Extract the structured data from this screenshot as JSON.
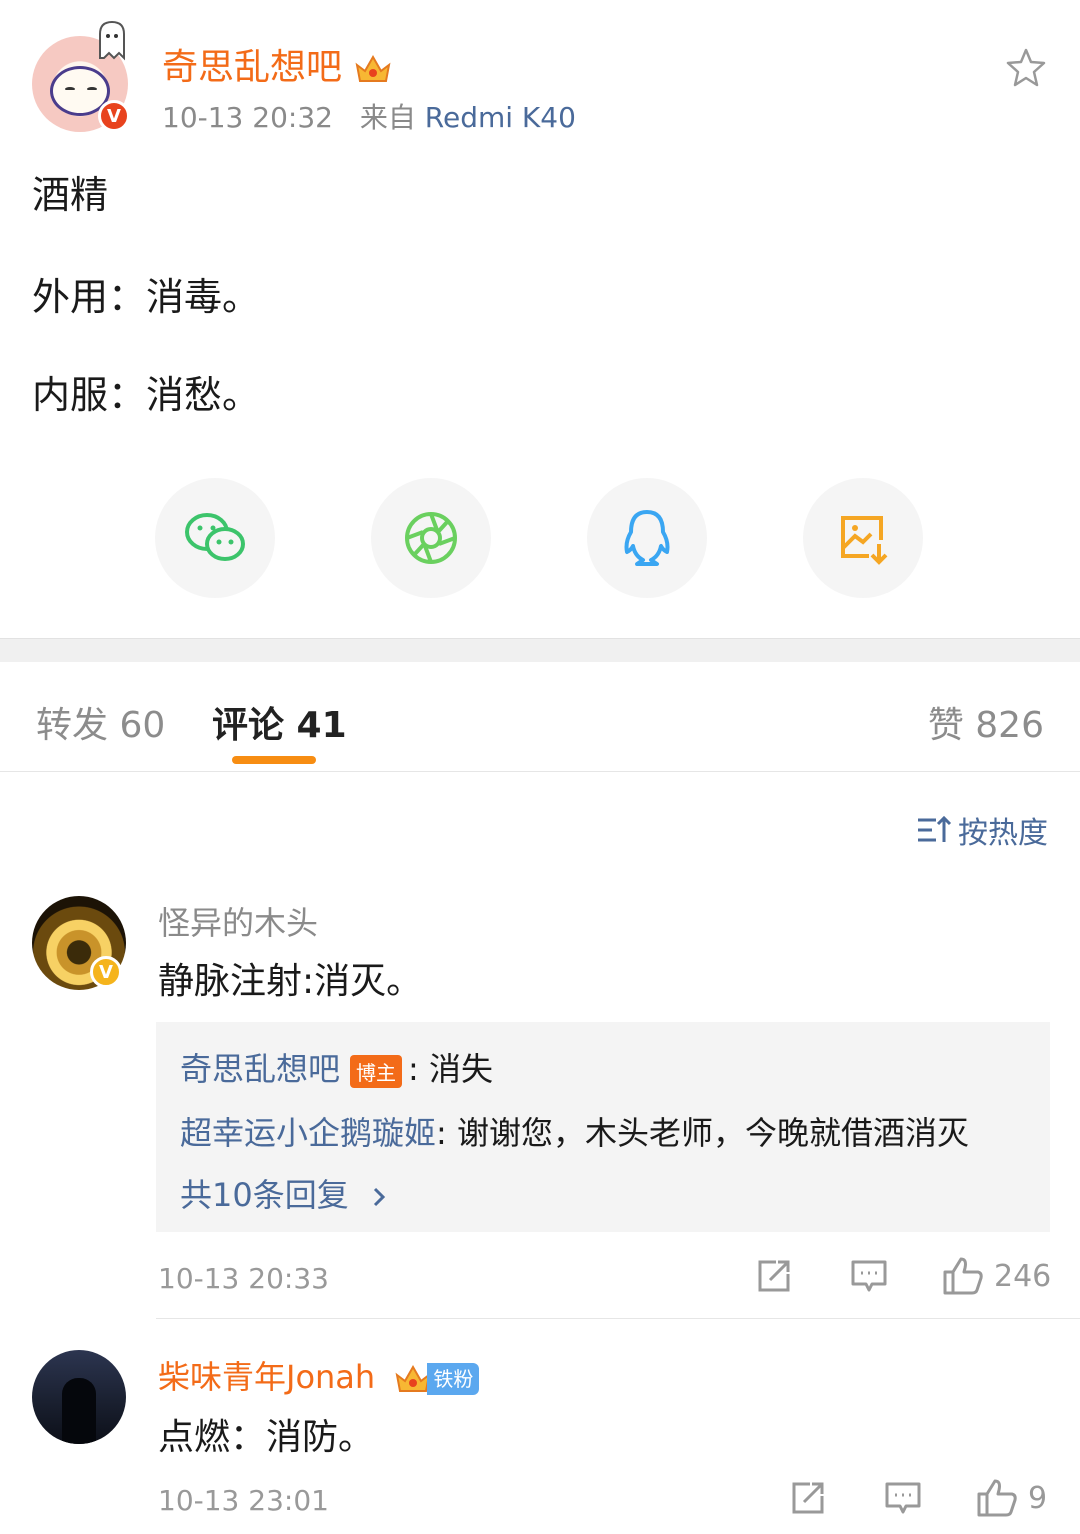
{
  "post": {
    "author": "奇思乱想吧",
    "time": "10-13 20:32",
    "source_prefix": "来自",
    "device": "Redmi K40",
    "lines": [
      "酒精",
      "外用：消毒。",
      "内服：消愁。"
    ]
  },
  "share": {
    "icons": [
      "wechat-icon",
      "moments-icon",
      "qq-icon",
      "save-image-icon"
    ],
    "colors": {
      "wechat": "#3cc46b",
      "moments": "#6ad05f",
      "qq": "#3aa6f2",
      "save": "#f5a623"
    }
  },
  "tabs": {
    "repost": "转发 60",
    "comments": "评论 41",
    "likes": "赞 826"
  },
  "sort": {
    "label": "按热度"
  },
  "comments": [
    {
      "user": "怪异的木头",
      "text": "静脉注射:消灭。",
      "replies": [
        {
          "user": "奇思乱想吧",
          "tag": "博主",
          "text": ": 消失"
        },
        {
          "user": "超幸运小企鹅璇姬",
          "text": ": 谢谢您，木头老师，今晚就借酒消灭"
        }
      ],
      "more_replies": "共10条回复",
      "time": "10-13 20:33",
      "likes": "246"
    },
    {
      "user": "柴味青年Jonah",
      "fan_badge": "铁粉",
      "text": "点燃：消防。",
      "time": "10-13 23:01",
      "likes": "9"
    }
  ],
  "colors": {
    "accent": "#f36b18",
    "link": "#4a6a9a",
    "tab_underline": "#f78d12"
  }
}
